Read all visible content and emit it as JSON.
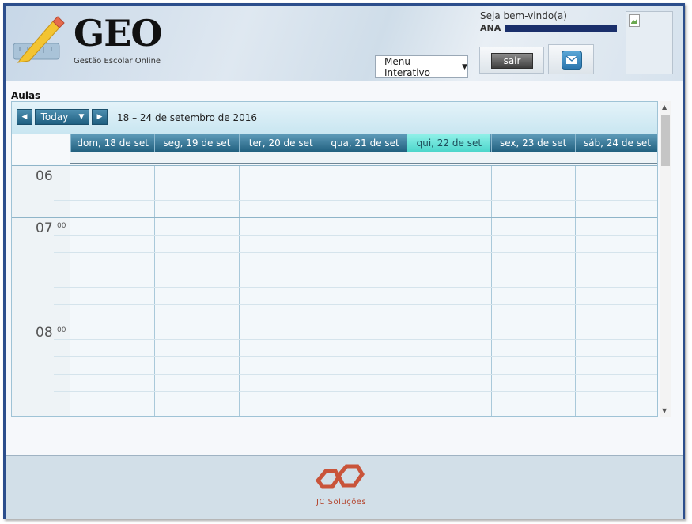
{
  "header": {
    "app_name": "GEO",
    "app_subtitle": "Gestão Escolar Online",
    "menu_label": "Menu Interativo",
    "welcome": "Seja bem-vindo(a)",
    "user_name_prefix": "ANA",
    "logout_label": "sair",
    "mail_icon": "mail-icon"
  },
  "calendar": {
    "section_title": "Aulas",
    "today_label": "Today",
    "date_range": "18 – 24 de setembro de 2016",
    "days": [
      {
        "label": "dom, 18 de set",
        "today": false
      },
      {
        "label": "seg, 19 de set",
        "today": false
      },
      {
        "label": "ter, 20 de set",
        "today": false
      },
      {
        "label": "qua, 21 de set",
        "today": false
      },
      {
        "label": "qui, 22 de set",
        "today": true
      },
      {
        "label": "sex, 23 de set",
        "today": false
      },
      {
        "label": "sáb, 24 de set",
        "today": false
      }
    ],
    "hours": [
      {
        "hour": "06",
        "minutes": ""
      },
      {
        "hour": "07",
        "minutes": "00"
      },
      {
        "hour": "08",
        "minutes": "00"
      }
    ],
    "colors": {
      "today": "#4cd6cb",
      "header": "#21607f"
    }
  },
  "footer": {
    "brand": "JC Soluções"
  }
}
